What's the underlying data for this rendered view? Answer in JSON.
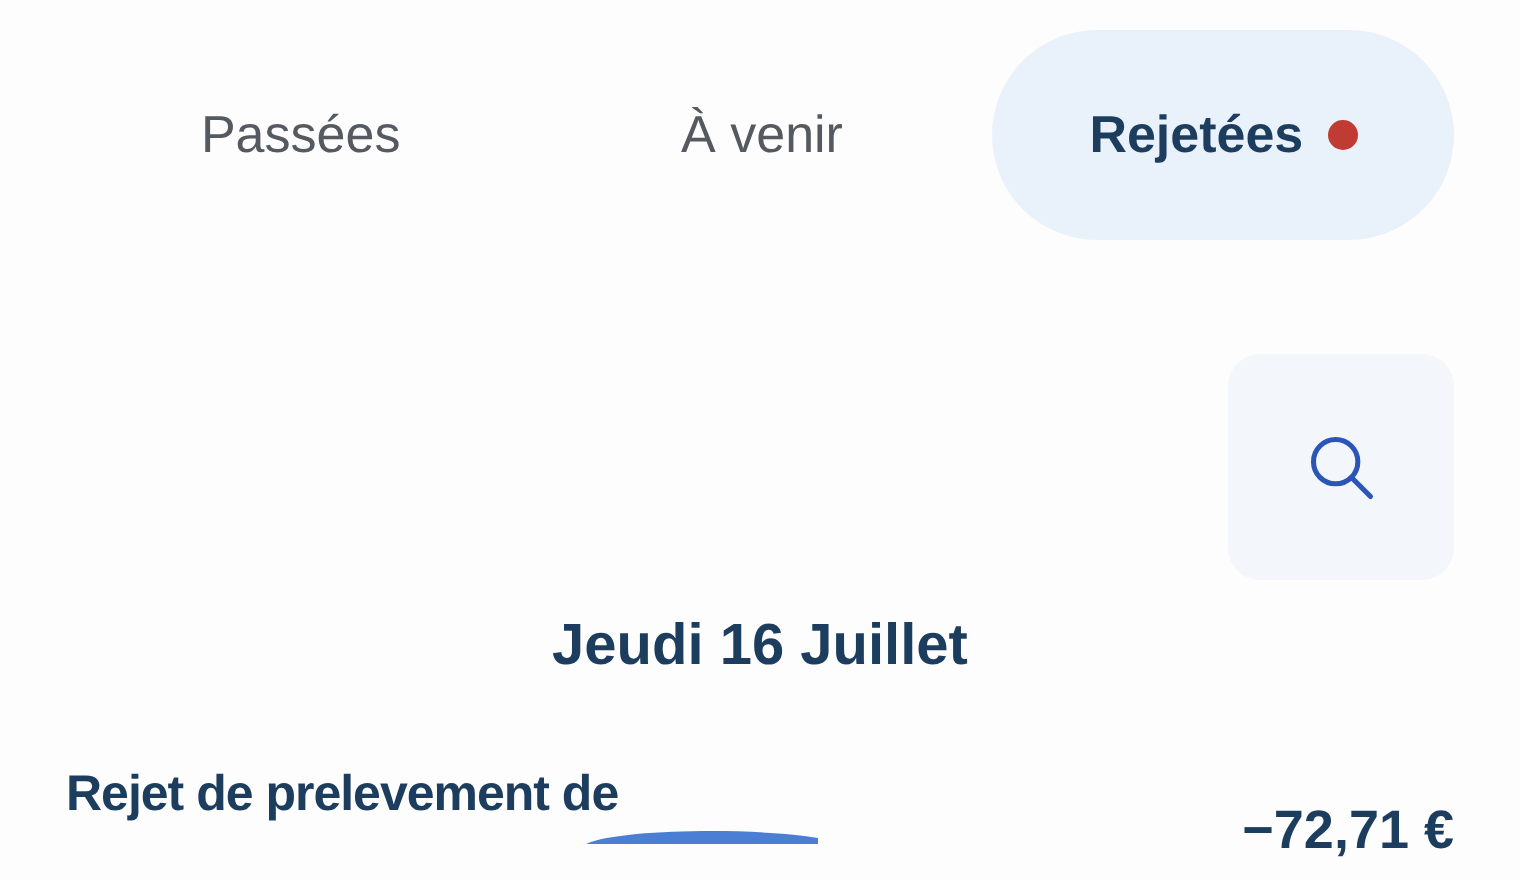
{
  "tabs": [
    {
      "label": "Passées",
      "selected": false,
      "alert": false
    },
    {
      "label": "À venir",
      "selected": false,
      "alert": false
    },
    {
      "label": "Rejetées",
      "selected": true,
      "alert": true
    }
  ],
  "date_heading": "Jeudi 16 Juillet",
  "transactions": [
    {
      "label": "Rejet de prelevement de",
      "amount": "−72,71 €",
      "redacted": true
    }
  ]
}
